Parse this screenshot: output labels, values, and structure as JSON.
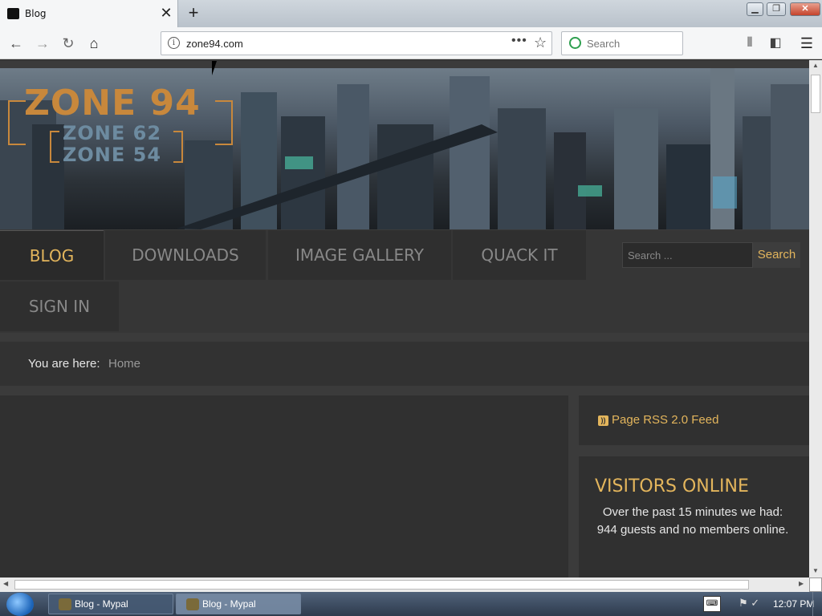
{
  "browser": {
    "tab_title": "Blog",
    "new_tab_symbol": "+",
    "tab_close_symbol": "✕",
    "url": "zone94.com",
    "search_placeholder": "Search",
    "icons": [
      "back-icon",
      "forward-icon",
      "reload-icon",
      "home-icon",
      "info-icon",
      "page-actions-icon",
      "bookmark-star-icon",
      "library-icon",
      "sidebar-icon",
      "menu-icon"
    ]
  },
  "site": {
    "logo": {
      "main": "ZONE 94",
      "sub1": "ZONE 62",
      "sub2": "ZONE 54"
    },
    "menu": [
      "BLOG",
      "DOWNLOADS",
      "IMAGE GALLERY",
      "QUACK IT",
      "SIGN IN"
    ],
    "search_placeholder": "Search ...",
    "search_button": "Search",
    "breadcrumb": {
      "label": "You are here:",
      "home": "Home"
    },
    "rss": "Page RSS 2.0 Feed",
    "visitors": {
      "title": "VISITORS ONLINE",
      "text": "Over the past 15 minutes we had: 944 guests and no members online."
    },
    "accent_color": "#e3b55c"
  },
  "taskbar": {
    "items": [
      "Blog - Mypal",
      "Blog - Mypal"
    ],
    "clock": "12:07 PM"
  }
}
